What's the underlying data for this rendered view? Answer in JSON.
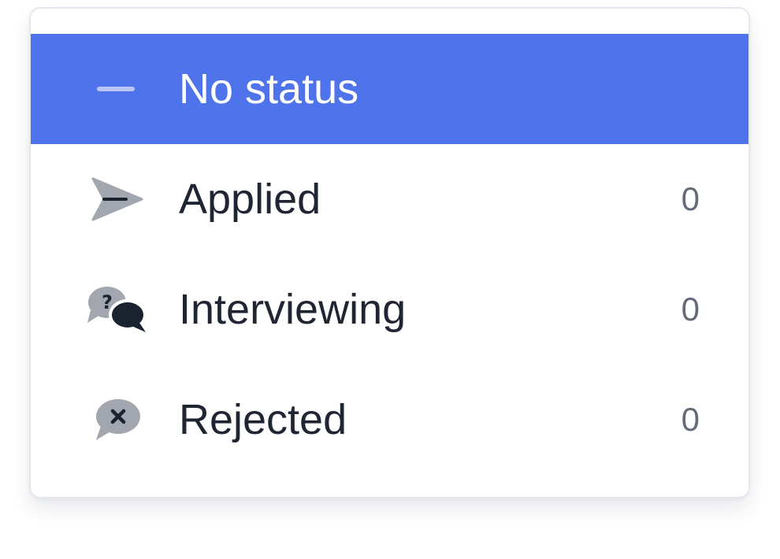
{
  "theme": {
    "accent": "#4f73ea",
    "icon_gray": "#a2a6ae",
    "icon_dark": "#1b2230"
  },
  "status_menu": {
    "items": [
      {
        "label": "No status",
        "count": "",
        "icon": "dash-icon",
        "selected": true
      },
      {
        "label": "Applied",
        "count": "0",
        "icon": "send-icon",
        "selected": false
      },
      {
        "label": "Interviewing",
        "count": "0",
        "icon": "chat-question-icon",
        "selected": false
      },
      {
        "label": "Rejected",
        "count": "0",
        "icon": "chat-x-icon",
        "selected": false
      }
    ]
  }
}
